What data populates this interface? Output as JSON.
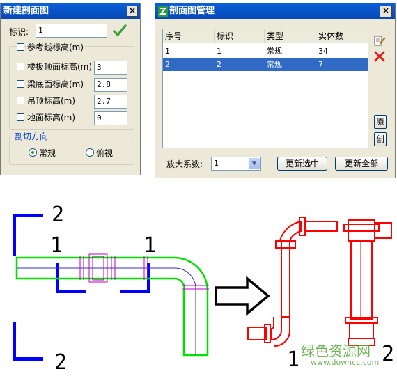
{
  "dialog_new": {
    "title": "新建剖面图",
    "close_label": "×",
    "id_label": "标识:",
    "id_value": "1",
    "ref_label": "参考线标高(m)",
    "rows": [
      {
        "label": "楼板顶面标高(m)",
        "value": "3"
      },
      {
        "label": "梁底面标高(m)",
        "value": "2.8"
      },
      {
        "label": "吊顶标高(m)",
        "value": "2.7"
      },
      {
        "label": "地面标高(m)",
        "value": "0"
      }
    ],
    "direction_group": "剖切方向",
    "radio_normal": "常规",
    "radio_top": "俯视"
  },
  "dialog_manage": {
    "title": "剖面图管理",
    "close_label": "×",
    "columns": [
      "序号",
      "标识",
      "类型",
      "实体数"
    ],
    "rows": [
      [
        "1",
        "1",
        "常规",
        "34"
      ],
      [
        "2",
        "2",
        "常规",
        "7"
      ]
    ],
    "selected_row": 1,
    "side_btn_orig": "原",
    "side_btn_cut": "剖",
    "zoom_label": "放大系数:",
    "zoom_value": "1",
    "update_selected": "更新选中",
    "update_all": "更新全部"
  },
  "drawing": {
    "section_labels": [
      "2",
      "1",
      "1",
      "2"
    ],
    "elevation_labels": [
      "1",
      "2"
    ],
    "colors": {
      "section_marker": "#0000ff",
      "pipe": "#00e000",
      "section_pipe": "#ff0000",
      "fitting": "#c000c0"
    }
  },
  "watermark": {
    "line1": "绿色资源网",
    "line2": "www.downcc.com"
  }
}
